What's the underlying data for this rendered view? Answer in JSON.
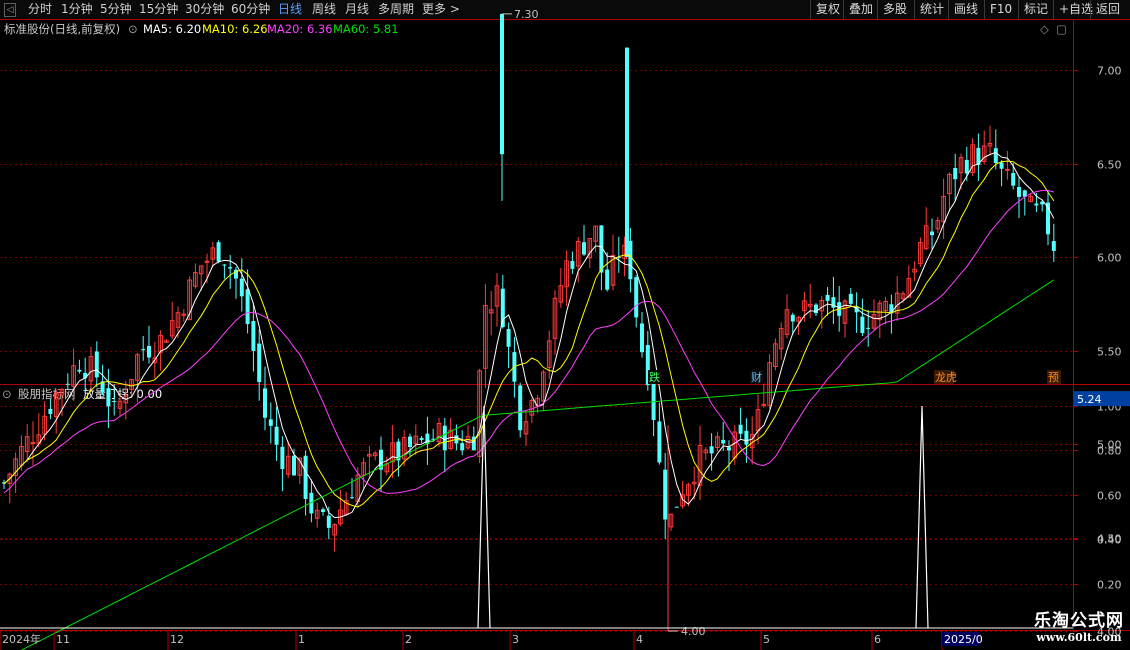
{
  "toolbar": {
    "left_items": [
      "分时",
      "1分钟",
      "5分钟",
      "15分钟",
      "30分钟",
      "60分钟",
      "日线",
      "周线",
      "月线",
      "多周期",
      "更多 >"
    ],
    "active": "日线",
    "right_items": [
      "复权",
      "叠加",
      "多股",
      "统计",
      "画线",
      "F10",
      "标记",
      "+自选",
      "返回"
    ]
  },
  "main_header": {
    "stock": "标准股份(日线,前复权)",
    "ma5": "MA5: 6.20",
    "ma10": "MA10: 6.26",
    "ma20": "MA20: 6.36",
    "ma60": "MA60: 5.81"
  },
  "sub_header": {
    "source": "股朋指标网",
    "indicator": "放量打拐: 0.00"
  },
  "price_axis": [
    "7.00",
    "6.50",
    "6.00",
    "5.50",
    "5.00",
    "4.50",
    "4.00"
  ],
  "current_price": "5.24",
  "markers": {
    "high": "7.30",
    "low": "4.00"
  },
  "event_tags": [
    "跌",
    "财",
    "龙虎",
    "预"
  ],
  "indicator_axis": [
    "1.00",
    "0.80",
    "0.60",
    "0.40",
    "0.20"
  ],
  "date_axis": [
    "2024年",
    "11",
    "12",
    "1",
    "2",
    "3",
    "4",
    "5",
    "6",
    "2025/0"
  ],
  "watermark": {
    "title": "乐淘公式网",
    "url": "www.60lt.com"
  },
  "colors": {
    "up": "#ff3c3c",
    "down": "#54ffff",
    "ma5": "#ffffff",
    "ma10": "#ffff00",
    "ma20": "#ff40ff",
    "ma60": "#00e000",
    "grid": "#7a0000",
    "axis": "#b00000"
  }
}
